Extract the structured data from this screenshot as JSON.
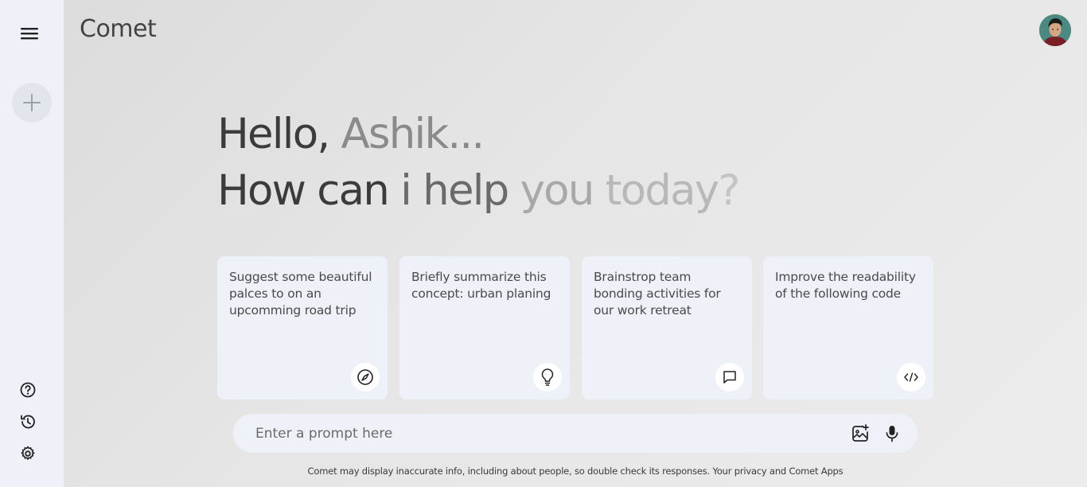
{
  "app": {
    "title": "Comet"
  },
  "greeting": {
    "hello": "Hello,",
    "name": "Ashik...",
    "line2_part1": "How can",
    "line2_part2": "i",
    "line2_part3": "help",
    "line2_part4": "you",
    "line2_part5": "today",
    "line2_part6": "?"
  },
  "cards": [
    {
      "text": "Suggest some beautiful palces to on an upcomming road trip",
      "icon": "compass-icon"
    },
    {
      "text": "Briefly summarize this concept: urban planing",
      "icon": "lightbulb-icon"
    },
    {
      "text": "Brainstrop team bonding activities for our work retreat",
      "icon": "message-icon"
    },
    {
      "text": "Improve the readability of the following code",
      "icon": "code-icon"
    }
  ],
  "prompt": {
    "placeholder": "Enter a prompt here",
    "value": ""
  },
  "disclaimer": {
    "text": "Comet may display inaccurate info, including about people, so double check its responses.",
    "link": "Your privacy and Comet Apps"
  },
  "colors": {
    "sidebar_bg": "#eef1f8",
    "main_bg": "#e6e6e6",
    "card_bg": "#eef1f8",
    "text_dark": "#3b3b3b"
  }
}
